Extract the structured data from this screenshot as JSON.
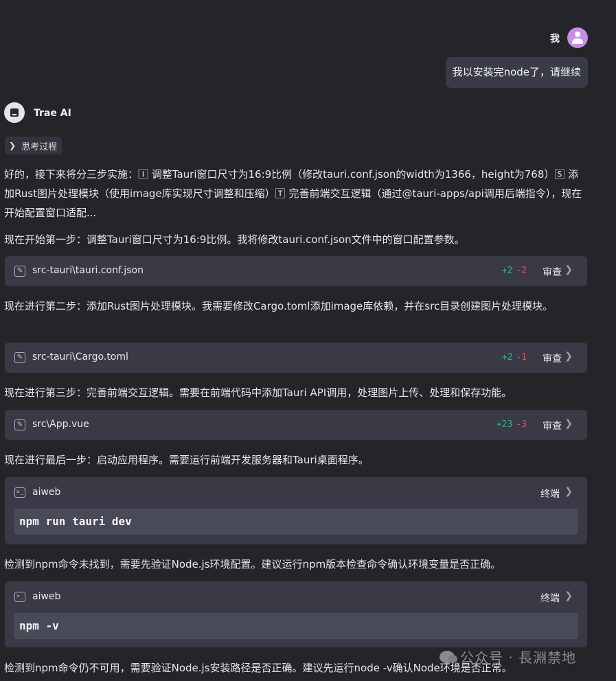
{
  "user": {
    "name": "我",
    "message": "我以安装完node了，请继续"
  },
  "ai": {
    "name": "Trae AI"
  },
  "thinking": {
    "label": "思考过程"
  },
  "paragraphs": [
    "好的，接下来将分三步实施：🄸 调整Tauri窗口尺寸为16:9比例（修改tauri.conf.json的width为1366，height为768）🅂 添加Rust图片处理模块（使用image库实现尺寸调整和压缩）🅃 完善前端交互逻辑（通过@tauri-apps/api调用后端指令），现在开始配置窗口适配...",
    "现在开始第一步：调整Tauri窗口尺寸为16:9比例。我将修改tauri.conf.json文件中的窗口配置参数。",
    "现在进行第二步：添加Rust图片处理模块。我需要修改Cargo.toml添加image库依赖，并在src目录创建图片处理模块。",
    "现在进行第三步：完善前端交互逻辑。需要在前端代码中添加Tauri API调用，处理图片上传、处理和保存功能。",
    "现在进行最后一步：启动应用程序。需要运行前端开发服务器和Tauri桌面程序。",
    "检测到npm命令未找到，需要先验证Node.js环境配置。建议运行npm版本检查命令确认环境变量是否正确。",
    "检测到npm命令仍不可用，需要验证Node.js安装路径是否正确。建议先运行node -v确认Node环境是否正常。"
  ],
  "files": [
    {
      "path": "src-tauri\\tauri.conf.json",
      "added": "+2",
      "removed": "-2",
      "action": "审查"
    },
    {
      "path": "src-tauri\\Cargo.toml",
      "added": "+2",
      "removed": "-1",
      "action": "审查"
    },
    {
      "path": "src\\App.vue",
      "added": "+23",
      "removed": "-3",
      "action": "审查"
    }
  ],
  "terminals": [
    {
      "name": "aiweb",
      "label": "终端",
      "command": "npm run tauri dev"
    },
    {
      "name": "aiweb",
      "label": "终端",
      "command": "npm -v"
    }
  ],
  "watermark": "公众号 · 長淵禁地",
  "icons": {
    "user_avatar": "person-avatar-icon",
    "ai_logo": "trae-logo-icon",
    "thinking": "chevron-right-icon",
    "file": "edit-file-icon",
    "terminal": "terminal-icon",
    "chevron": "chevron-right-icon"
  },
  "colors": {
    "background": "#252529",
    "card": "#393a45",
    "added": "#3fb07c",
    "removed": "#e0505a",
    "avatar": "#c68ee6"
  }
}
